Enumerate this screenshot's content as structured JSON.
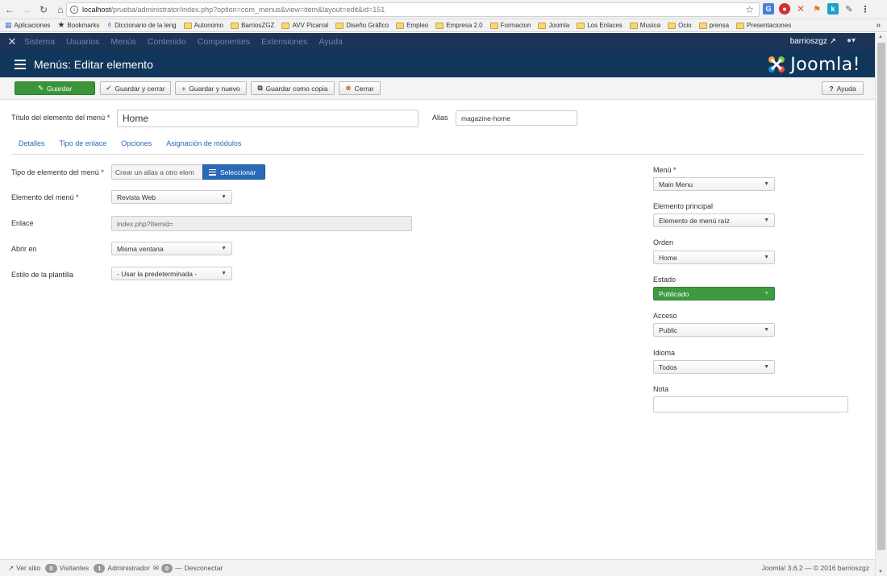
{
  "browser": {
    "url_host": "localhost",
    "url_path": "/prueba/administrator/index.php?option=com_menus&view=item&layout=edit&id=151",
    "bookmarks": [
      "Aplicaciones",
      "Bookmarks",
      "Diccionario de la leng",
      "Autonomo",
      "BarriosZGZ",
      "AVV Picarral",
      "Diseño Gráfico",
      "Empleo",
      "Empresa 2.0",
      "Formacion",
      "Joomla",
      "Los Enlaces",
      "Musica",
      "Ocio",
      "prensa",
      "Presentaciones"
    ],
    "more": "»"
  },
  "admin_nav": {
    "items": [
      "Sistema",
      "Usuarios",
      "Menús",
      "Contenido",
      "Componentes",
      "Extensiones",
      "Ayuda"
    ],
    "user": "barrioszgz"
  },
  "header": {
    "title": "Menús: Editar elemento",
    "logo_text": "Joomla!"
  },
  "toolbar": {
    "save": "Guardar",
    "save_close": "Guardar y cerrar",
    "save_new": "Guardar y nuevo",
    "save_copy": "Guardar como copia",
    "close": "Cerrar",
    "help": "Ayuda"
  },
  "form": {
    "title_label": "Título del elemento del menú *",
    "title_value": "Home",
    "alias_label": "Alias",
    "alias_value": "magazine-home",
    "tabs": [
      "Detalles",
      "Tipo de enlace",
      "Opciones",
      "Asignación de módulos"
    ],
    "type_label": "Tipo de elemento del menú *",
    "type_alias_btn": "Crear un alias a otro elem",
    "type_select_btn": "Seleccionar",
    "item_label": "Elemento del menú *",
    "item_value": "Revista Web",
    "link_label": "Enlace",
    "link_value": "index.php?Itemid=",
    "open_label": "Abrir en",
    "open_value": "Misma ventana",
    "style_label": "Estilo de la plantilla",
    "style_value": "- Usar la predeterminada -"
  },
  "sidebar": {
    "menu_label": "Menú *",
    "menu_value": "Main Menu",
    "parent_label": "Elemento principal",
    "parent_value": "Elemento de menú raíz",
    "order_label": "Orden",
    "order_value": "Home",
    "status_label": "Estado",
    "status_value": "Publicado",
    "access_label": "Acceso",
    "access_value": "Public",
    "language_label": "Idioma",
    "language_value": "Todos",
    "note_label": "Nota",
    "note_value": ""
  },
  "footer": {
    "view_site": "Ver sitio",
    "visitors_count": "0",
    "visitors_label": "Visitantes",
    "admin_count": "1",
    "admin_label": "Administrador",
    "messages_count": "0",
    "logout": "Desconectar",
    "version": "Joomla! 3.6.2 — © 2016 barrioszgz"
  },
  "colors": {
    "admin_nav_bg": "#1b3458",
    "header_bg": "#10365c",
    "save_green": "#3a953a",
    "select_blue": "#2a69b8"
  }
}
